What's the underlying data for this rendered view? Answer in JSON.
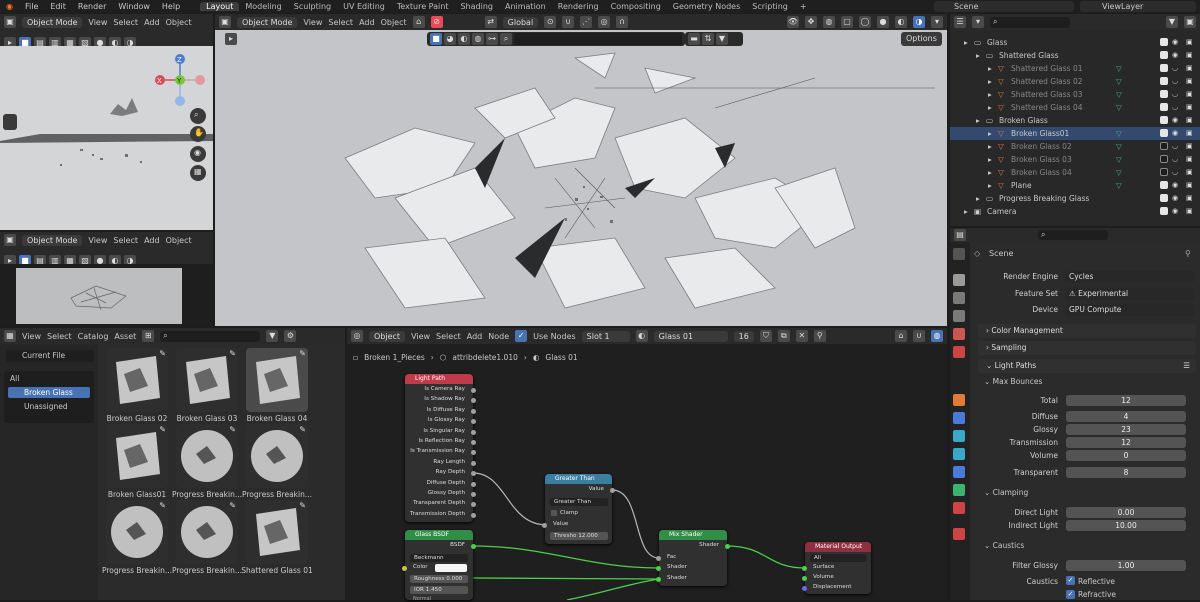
{
  "menu": [
    "File",
    "Edit",
    "Render",
    "Window",
    "Help"
  ],
  "workspaces": [
    "Layout",
    "Modeling",
    "Sculpting",
    "UV Editing",
    "Texture Paint",
    "Shading",
    "Animation",
    "Rendering",
    "Compositing",
    "Geometry Nodes",
    "Scripting"
  ],
  "active_workspace": "Layout",
  "add_ws": "+",
  "scene": "Scene",
  "viewlayer": "ViewLayer",
  "vp_left_top": {
    "mode": "Object Mode",
    "menus": [
      "View",
      "Select",
      "Add",
      "Object"
    ]
  },
  "vp_left_bottom": {
    "mode": "Object Mode",
    "menus": [
      "View",
      "Select",
      "Add",
      "Object"
    ]
  },
  "vp_main": {
    "mode": "Object Mode",
    "menus": [
      "View",
      "Select",
      "Add",
      "Object"
    ],
    "transform": "Global",
    "options": "Options"
  },
  "gizmo": {
    "x": "X",
    "y": "Y",
    "z": "Z"
  },
  "outliner": [
    {
      "name": "Glass",
      "indent": 0,
      "icon": "collection-icon"
    },
    {
      "name": "Shattered Glass",
      "indent": 1,
      "icon": "collection-icon"
    },
    {
      "name": "Shattered Glass 01",
      "indent": 2,
      "icon": "mesh-icon",
      "dim": true
    },
    {
      "name": "Shattered Glass 02",
      "indent": 2,
      "icon": "mesh-icon",
      "dim": true
    },
    {
      "name": "Shattered Glass 03",
      "indent": 2,
      "icon": "mesh-icon",
      "dim": true
    },
    {
      "name": "Shattered Glass 04",
      "indent": 2,
      "icon": "mesh-icon",
      "dim": true
    },
    {
      "name": "Broken Glass",
      "indent": 1,
      "icon": "collection-icon"
    },
    {
      "name": "Broken Glass01",
      "indent": 2,
      "icon": "mesh-icon"
    },
    {
      "name": "Broken Glass 02",
      "indent": 2,
      "icon": "mesh-icon",
      "dim": true
    },
    {
      "name": "Broken Glass 03",
      "indent": 2,
      "icon": "mesh-icon",
      "dim": true
    },
    {
      "name": "Broken Glass 04",
      "indent": 2,
      "icon": "mesh-icon",
      "dim": true
    },
    {
      "name": "Plane",
      "indent": 2,
      "icon": "mesh-icon"
    },
    {
      "name": "Progress Breaking Glass",
      "indent": 1,
      "icon": "collection-icon"
    },
    {
      "name": "Camera",
      "indent": 0,
      "icon": "camera-icon"
    }
  ],
  "props": {
    "scene_label": "Scene",
    "render_engine_label": "Render Engine",
    "render_engine": "Cycles",
    "feature_set_label": "Feature Set",
    "feature_set": "Experimental",
    "device_label": "Device",
    "device": "GPU Compute",
    "sections": [
      "Color Management",
      "Sampling",
      "Light Paths",
      "Max Bounces",
      "Clamping",
      "Caustics"
    ],
    "bounces": [
      {
        "label": "Total",
        "value": "12"
      },
      {
        "label": "Diffuse",
        "value": "4"
      },
      {
        "label": "Glossy",
        "value": "23"
      },
      {
        "label": "Transmission",
        "value": "12"
      },
      {
        "label": "Volume",
        "value": "0"
      },
      {
        "label": "Transparent",
        "value": "8"
      }
    ],
    "direct_light_label": "Direct Light",
    "direct_light": "0.00",
    "indirect_light_label": "Indirect Light",
    "indirect_light": "10.00",
    "filter_glossy_label": "Filter Glossy",
    "filter_glossy": "1.00",
    "caustics_label": "Caustics",
    "reflective": "Reflective",
    "refractive": "Refractive"
  },
  "asset_browser": {
    "menus": [
      "View",
      "Select",
      "Catalog",
      "Asset"
    ],
    "library": "Current File",
    "catalogs": [
      "All",
      "Broken Glass",
      "Unassigned"
    ],
    "assets": [
      "Broken Glass 02",
      "Broken Glass 03",
      "Broken Glass 04",
      "Broken Glass01",
      "Progress Breakin...",
      "Progress Breakin...",
      "Progress Breakin...",
      "Progress Breakin...",
      "Shattered Glass 01"
    ]
  },
  "node_editor": {
    "type": "Object",
    "menus": [
      "View",
      "Select",
      "Add",
      "Node"
    ],
    "use_nodes": "Use Nodes",
    "slot": "Slot 1",
    "material": "Glass 01",
    "users": "16",
    "breadcrumb": [
      "Broken 1_Pieces",
      "attribdelete1.010",
      "Glass 01"
    ]
  },
  "nodes": {
    "light_path": {
      "title": "Light Path",
      "outputs": [
        "Is Camera Ray",
        "Is Shadow Ray",
        "Is Diffuse Ray",
        "Is Glossy Ray",
        "Is Singular Ray",
        "Is Reflection Ray",
        "Is Transmission Ray",
        "Ray Length",
        "Ray Depth",
        "Diffuse Depth",
        "Glossy Depth",
        "Transparent Depth",
        "Transmission Depth"
      ]
    },
    "greater_than": {
      "title": "Greater Than",
      "output": "Value",
      "op": "Greater Than",
      "clamp": "Clamp",
      "input": "Value",
      "thresh_label": "Thresho",
      "thresh": "12.000"
    },
    "glass": {
      "title": "Glass BSDF",
      "output": "BSDF",
      "dist": "Beckmann",
      "color_label": "Color",
      "rough_label": "Roughness",
      "rough": "0.000",
      "ior_label": "IOR",
      "ior": "1.450",
      "normal": "Normal"
    },
    "mix": {
      "title": "Mix Shader",
      "output": "Shader",
      "fac": "Fac",
      "s1": "Shader",
      "s2": "Shader"
    },
    "output": {
      "title": "Material Output",
      "target": "All",
      "surface": "Surface",
      "volume": "Volume",
      "disp": "Displacement"
    }
  }
}
